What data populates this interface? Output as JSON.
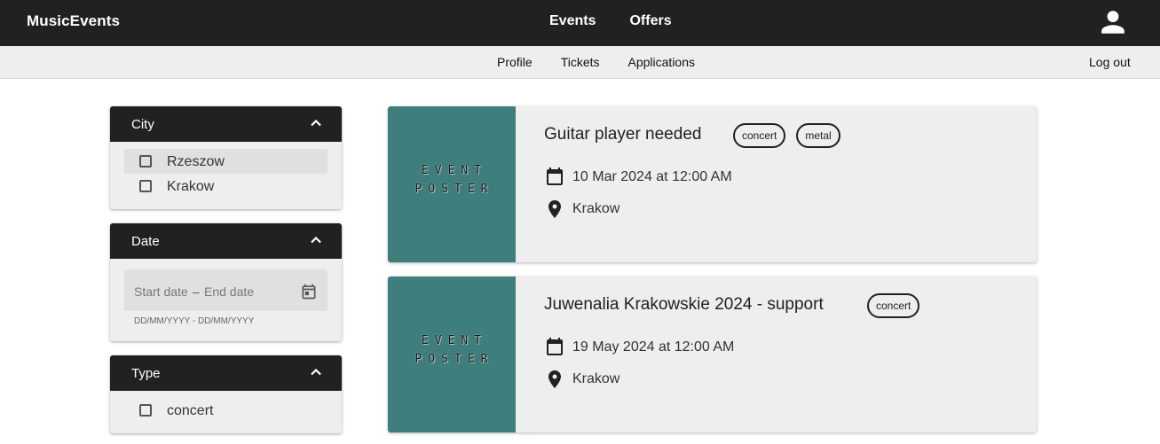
{
  "app": {
    "brand": "MusicEvents",
    "nav": [
      "Events",
      "Offers"
    ],
    "user_icon": "account-icon"
  },
  "subnav": {
    "profile": "Profile",
    "tickets": "Tickets",
    "applications": "Applications",
    "logout": "Log out"
  },
  "filters": {
    "city": {
      "title": "City",
      "options": [
        {
          "label": "Rzeszow",
          "checked": false
        },
        {
          "label": "Krakow",
          "checked": false
        }
      ]
    },
    "date": {
      "title": "Date",
      "start_placeholder": "Start date",
      "separator": "–",
      "end_placeholder": "End date",
      "hint": "DD/MM/YYYY - DD/MM/YYYY"
    },
    "type": {
      "title": "Type",
      "options": [
        {
          "label": "concert",
          "checked": false
        }
      ]
    }
  },
  "events": [
    {
      "poster_line1": "EVENT",
      "poster_line2": "POSTER",
      "title": "Guitar player needed",
      "tags": [
        "concert",
        "metal"
      ],
      "date": "10 Mar 2024 at 12:00 AM",
      "location": "Krakow"
    },
    {
      "poster_line1": "EVENT",
      "poster_line2": "POSTER",
      "title": "Juwenalia Krakowskie 2024 - support",
      "tags": [
        "concert"
      ],
      "date": "19 May 2024 at 12:00 AM",
      "location": "Krakow"
    }
  ],
  "colors": {
    "topbar": "#212121",
    "subbar": "#eeeeee",
    "poster": "#3e7f7e",
    "card": "#eeeeee"
  }
}
